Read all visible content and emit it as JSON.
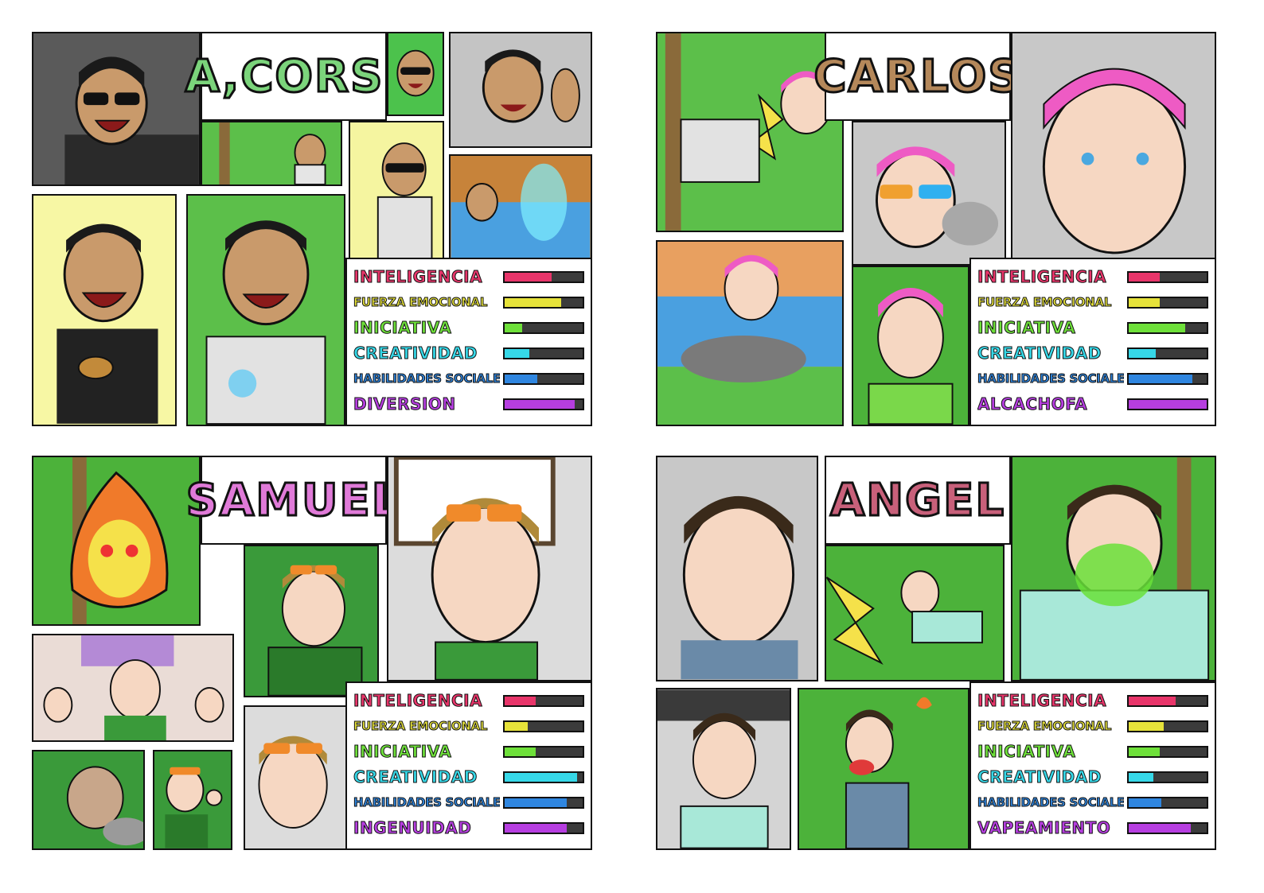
{
  "colors": {
    "inteligencia": "#e8356a",
    "fuerza": "#e6e23a",
    "iniciativa": "#6ee03a",
    "creatividad": "#36d8e8",
    "habilidades": "#2f86e0",
    "extra": "#b63ee0",
    "track": "#3b3b3b"
  },
  "characters": [
    {
      "name": "A,CORSI",
      "stats": [
        {
          "label": "INTELIGENCIA",
          "value": 0.6
        },
        {
          "label": "FUERZA EMOCIONAL",
          "value": 0.72
        },
        {
          "label": "INICIATIVA",
          "value": 0.22
        },
        {
          "label": "CREATIVIDAD",
          "value": 0.32
        },
        {
          "label": "HABILIDADES SOCIALES",
          "value": 0.42
        },
        {
          "label": "DIVERSION",
          "value": 0.9
        }
      ]
    },
    {
      "name": "CARLOS",
      "stats": [
        {
          "label": "INTELIGENCIA",
          "value": 0.4
        },
        {
          "label": "FUERZA EMOCIONAL",
          "value": 0.4
        },
        {
          "label": "INICIATIVA",
          "value": 0.72
        },
        {
          "label": "CREATIVIDAD",
          "value": 0.35
        },
        {
          "label": "HABILIDADES SOCIALES",
          "value": 0.82
        },
        {
          "label": "ALCACHOFA",
          "value": 1.0
        }
      ]
    },
    {
      "name": "SAMUEL",
      "stats": [
        {
          "label": "INTELIGENCIA",
          "value": 0.4
        },
        {
          "label": "FUERZA EMOCIONAL",
          "value": 0.3
        },
        {
          "label": "INICIATIVA",
          "value": 0.4
        },
        {
          "label": "CREATIVIDAD",
          "value": 0.93
        },
        {
          "label": "HABILIDADES SOCIALES",
          "value": 0.8
        },
        {
          "label": "INGENUIDAD",
          "value": 0.8
        }
      ]
    },
    {
      "name": "ANGEL",
      "stats": [
        {
          "label": "INTELIGENCIA",
          "value": 0.6
        },
        {
          "label": "FUERZA EMOCIONAL",
          "value": 0.45
        },
        {
          "label": "INICIATIVA",
          "value": 0.4
        },
        {
          "label": "CREATIVIDAD",
          "value": 0.32
        },
        {
          "label": "HABILIDADES SOCIALES",
          "value": 0.42
        },
        {
          "label": "VAPEAMIENTO",
          "value": 0.8
        }
      ]
    }
  ]
}
